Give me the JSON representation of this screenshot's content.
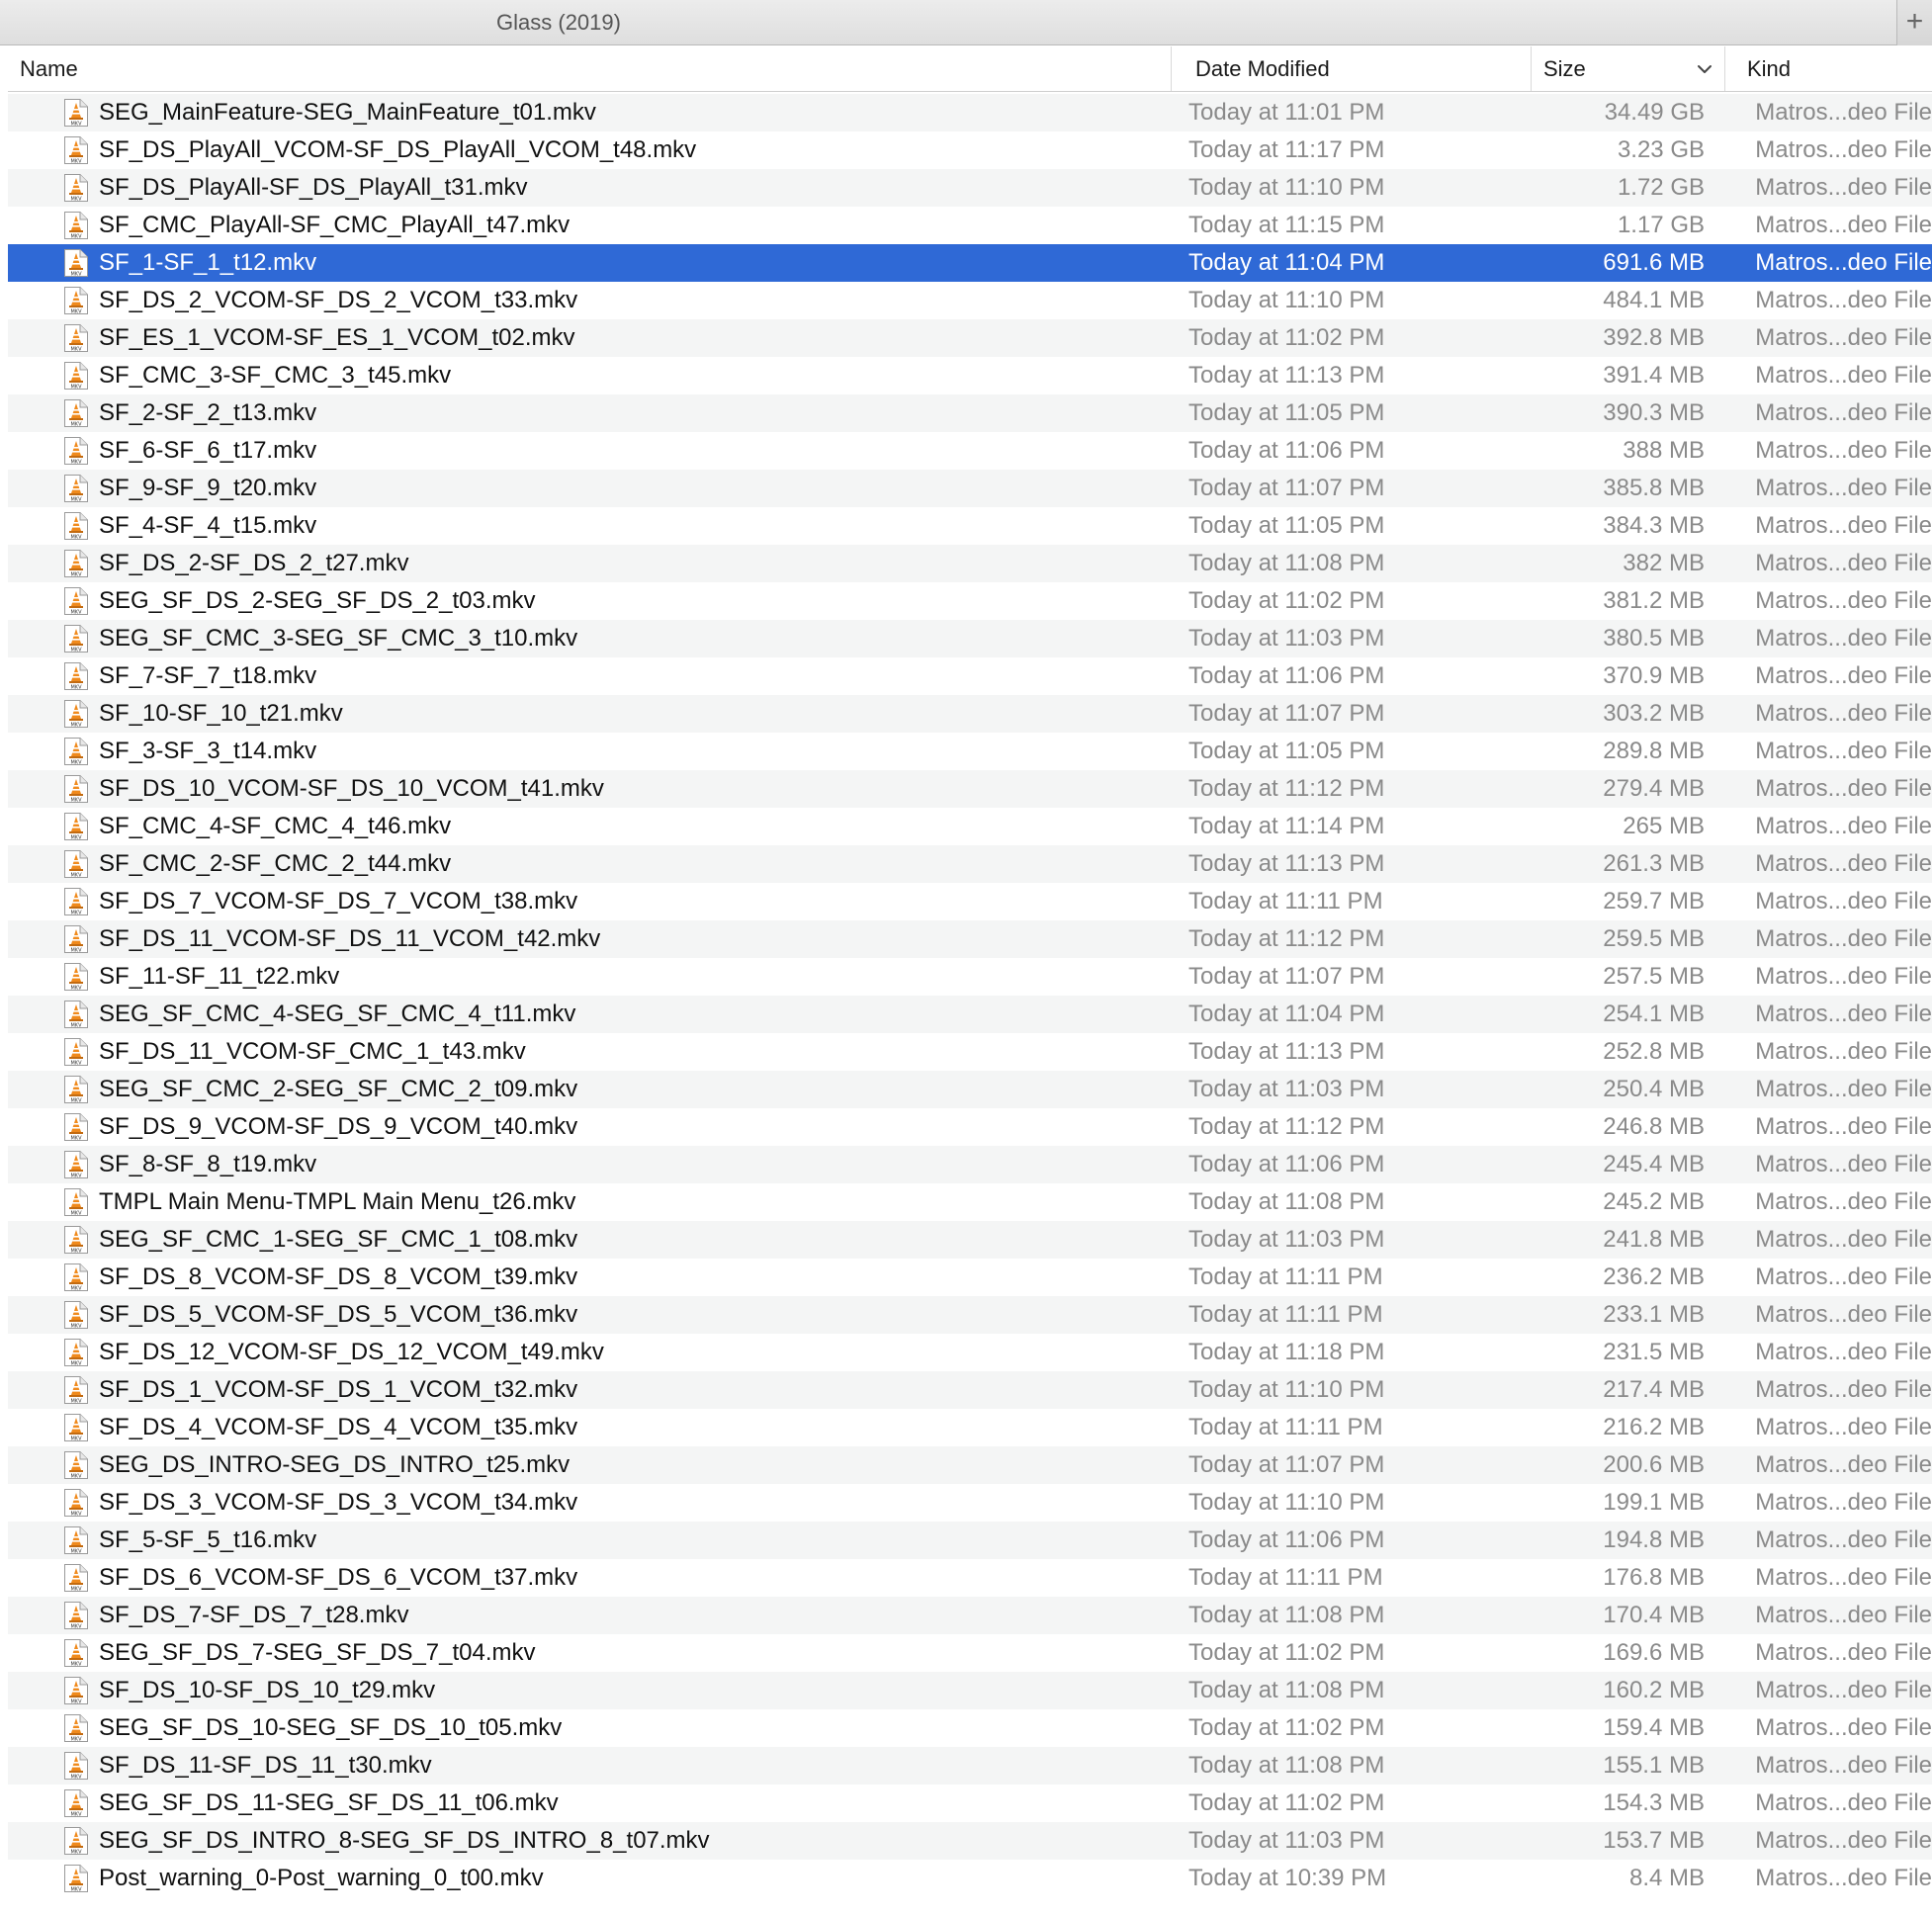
{
  "window": {
    "title": "Glass (2019)",
    "add_tab_label": "+"
  },
  "columns": {
    "name": "Name",
    "date": "Date Modified",
    "size": "Size",
    "kind": "Kind"
  },
  "selected_index": 4,
  "files": [
    {
      "name": "SEG_MainFeature-SEG_MainFeature_t01.mkv",
      "date": "Today at 11:01 PM",
      "size": "34.49 GB",
      "kind": "Matros...deo File"
    },
    {
      "name": "SF_DS_PlayAll_VCOM-SF_DS_PlayAll_VCOM_t48.mkv",
      "date": "Today at 11:17 PM",
      "size": "3.23 GB",
      "kind": "Matros...deo File"
    },
    {
      "name": "SF_DS_PlayAll-SF_DS_PlayAll_t31.mkv",
      "date": "Today at 11:10 PM",
      "size": "1.72 GB",
      "kind": "Matros...deo File"
    },
    {
      "name": "SF_CMC_PlayAll-SF_CMC_PlayAll_t47.mkv",
      "date": "Today at 11:15 PM",
      "size": "1.17 GB",
      "kind": "Matros...deo File"
    },
    {
      "name": "SF_1-SF_1_t12.mkv",
      "date": "Today at 11:04 PM",
      "size": "691.6 MB",
      "kind": "Matros...deo File"
    },
    {
      "name": "SF_DS_2_VCOM-SF_DS_2_VCOM_t33.mkv",
      "date": "Today at 11:10 PM",
      "size": "484.1 MB",
      "kind": "Matros...deo File"
    },
    {
      "name": "SF_ES_1_VCOM-SF_ES_1_VCOM_t02.mkv",
      "date": "Today at 11:02 PM",
      "size": "392.8 MB",
      "kind": "Matros...deo File"
    },
    {
      "name": "SF_CMC_3-SF_CMC_3_t45.mkv",
      "date": "Today at 11:13 PM",
      "size": "391.4 MB",
      "kind": "Matros...deo File"
    },
    {
      "name": "SF_2-SF_2_t13.mkv",
      "date": "Today at 11:05 PM",
      "size": "390.3 MB",
      "kind": "Matros...deo File"
    },
    {
      "name": "SF_6-SF_6_t17.mkv",
      "date": "Today at 11:06 PM",
      "size": "388 MB",
      "kind": "Matros...deo File"
    },
    {
      "name": "SF_9-SF_9_t20.mkv",
      "date": "Today at 11:07 PM",
      "size": "385.8 MB",
      "kind": "Matros...deo File"
    },
    {
      "name": "SF_4-SF_4_t15.mkv",
      "date": "Today at 11:05 PM",
      "size": "384.3 MB",
      "kind": "Matros...deo File"
    },
    {
      "name": "SF_DS_2-SF_DS_2_t27.mkv",
      "date": "Today at 11:08 PM",
      "size": "382 MB",
      "kind": "Matros...deo File"
    },
    {
      "name": "SEG_SF_DS_2-SEG_SF_DS_2_t03.mkv",
      "date": "Today at 11:02 PM",
      "size": "381.2 MB",
      "kind": "Matros...deo File"
    },
    {
      "name": "SEG_SF_CMC_3-SEG_SF_CMC_3_t10.mkv",
      "date": "Today at 11:03 PM",
      "size": "380.5 MB",
      "kind": "Matros...deo File"
    },
    {
      "name": "SF_7-SF_7_t18.mkv",
      "date": "Today at 11:06 PM",
      "size": "370.9 MB",
      "kind": "Matros...deo File"
    },
    {
      "name": "SF_10-SF_10_t21.mkv",
      "date": "Today at 11:07 PM",
      "size": "303.2 MB",
      "kind": "Matros...deo File"
    },
    {
      "name": "SF_3-SF_3_t14.mkv",
      "date": "Today at 11:05 PM",
      "size": "289.8 MB",
      "kind": "Matros...deo File"
    },
    {
      "name": "SF_DS_10_VCOM-SF_DS_10_VCOM_t41.mkv",
      "date": "Today at 11:12 PM",
      "size": "279.4 MB",
      "kind": "Matros...deo File"
    },
    {
      "name": "SF_CMC_4-SF_CMC_4_t46.mkv",
      "date": "Today at 11:14 PM",
      "size": "265 MB",
      "kind": "Matros...deo File"
    },
    {
      "name": "SF_CMC_2-SF_CMC_2_t44.mkv",
      "date": "Today at 11:13 PM",
      "size": "261.3 MB",
      "kind": "Matros...deo File"
    },
    {
      "name": "SF_DS_7_VCOM-SF_DS_7_VCOM_t38.mkv",
      "date": "Today at 11:11 PM",
      "size": "259.7 MB",
      "kind": "Matros...deo File"
    },
    {
      "name": "SF_DS_11_VCOM-SF_DS_11_VCOM_t42.mkv",
      "date": "Today at 11:12 PM",
      "size": "259.5 MB",
      "kind": "Matros...deo File"
    },
    {
      "name": "SF_11-SF_11_t22.mkv",
      "date": "Today at 11:07 PM",
      "size": "257.5 MB",
      "kind": "Matros...deo File"
    },
    {
      "name": "SEG_SF_CMC_4-SEG_SF_CMC_4_t11.mkv",
      "date": "Today at 11:04 PM",
      "size": "254.1 MB",
      "kind": "Matros...deo File"
    },
    {
      "name": "SF_DS_11_VCOM-SF_CMC_1_t43.mkv",
      "date": "Today at 11:13 PM",
      "size": "252.8 MB",
      "kind": "Matros...deo File"
    },
    {
      "name": "SEG_SF_CMC_2-SEG_SF_CMC_2_t09.mkv",
      "date": "Today at 11:03 PM",
      "size": "250.4 MB",
      "kind": "Matros...deo File"
    },
    {
      "name": "SF_DS_9_VCOM-SF_DS_9_VCOM_t40.mkv",
      "date": "Today at 11:12 PM",
      "size": "246.8 MB",
      "kind": "Matros...deo File"
    },
    {
      "name": "SF_8-SF_8_t19.mkv",
      "date": "Today at 11:06 PM",
      "size": "245.4 MB",
      "kind": "Matros...deo File"
    },
    {
      "name": "TMPL Main Menu-TMPL Main Menu_t26.mkv",
      "date": "Today at 11:08 PM",
      "size": "245.2 MB",
      "kind": "Matros...deo File"
    },
    {
      "name": "SEG_SF_CMC_1-SEG_SF_CMC_1_t08.mkv",
      "date": "Today at 11:03 PM",
      "size": "241.8 MB",
      "kind": "Matros...deo File"
    },
    {
      "name": "SF_DS_8_VCOM-SF_DS_8_VCOM_t39.mkv",
      "date": "Today at 11:11 PM",
      "size": "236.2 MB",
      "kind": "Matros...deo File"
    },
    {
      "name": "SF_DS_5_VCOM-SF_DS_5_VCOM_t36.mkv",
      "date": "Today at 11:11 PM",
      "size": "233.1 MB",
      "kind": "Matros...deo File"
    },
    {
      "name": "SF_DS_12_VCOM-SF_DS_12_VCOM_t49.mkv",
      "date": "Today at 11:18 PM",
      "size": "231.5 MB",
      "kind": "Matros...deo File"
    },
    {
      "name": "SF_DS_1_VCOM-SF_DS_1_VCOM_t32.mkv",
      "date": "Today at 11:10 PM",
      "size": "217.4 MB",
      "kind": "Matros...deo File"
    },
    {
      "name": "SF_DS_4_VCOM-SF_DS_4_VCOM_t35.mkv",
      "date": "Today at 11:11 PM",
      "size": "216.2 MB",
      "kind": "Matros...deo File"
    },
    {
      "name": "SEG_DS_INTRO-SEG_DS_INTRO_t25.mkv",
      "date": "Today at 11:07 PM",
      "size": "200.6 MB",
      "kind": "Matros...deo File"
    },
    {
      "name": "SF_DS_3_VCOM-SF_DS_3_VCOM_t34.mkv",
      "date": "Today at 11:10 PM",
      "size": "199.1 MB",
      "kind": "Matros...deo File"
    },
    {
      "name": "SF_5-SF_5_t16.mkv",
      "date": "Today at 11:06 PM",
      "size": "194.8 MB",
      "kind": "Matros...deo File"
    },
    {
      "name": "SF_DS_6_VCOM-SF_DS_6_VCOM_t37.mkv",
      "date": "Today at 11:11 PM",
      "size": "176.8 MB",
      "kind": "Matros...deo File"
    },
    {
      "name": "SF_DS_7-SF_DS_7_t28.mkv",
      "date": "Today at 11:08 PM",
      "size": "170.4 MB",
      "kind": "Matros...deo File"
    },
    {
      "name": "SEG_SF_DS_7-SEG_SF_DS_7_t04.mkv",
      "date": "Today at 11:02 PM",
      "size": "169.6 MB",
      "kind": "Matros...deo File"
    },
    {
      "name": "SF_DS_10-SF_DS_10_t29.mkv",
      "date": "Today at 11:08 PM",
      "size": "160.2 MB",
      "kind": "Matros...deo File"
    },
    {
      "name": "SEG_SF_DS_10-SEG_SF_DS_10_t05.mkv",
      "date": "Today at 11:02 PM",
      "size": "159.4 MB",
      "kind": "Matros...deo File"
    },
    {
      "name": "SF_DS_11-SF_DS_11_t30.mkv",
      "date": "Today at 11:08 PM",
      "size": "155.1 MB",
      "kind": "Matros...deo File"
    },
    {
      "name": "SEG_SF_DS_11-SEG_SF_DS_11_t06.mkv",
      "date": "Today at 11:02 PM",
      "size": "154.3 MB",
      "kind": "Matros...deo File"
    },
    {
      "name": "SEG_SF_DS_INTRO_8-SEG_SF_DS_INTRO_8_t07.mkv",
      "date": "Today at 11:03 PM",
      "size": "153.7 MB",
      "kind": "Matros...deo File"
    },
    {
      "name": "Post_warning_0-Post_warning_0_t00.mkv",
      "date": "Today at 10:39 PM",
      "size": "8.4 MB",
      "kind": "Matros...deo File"
    }
  ],
  "icons": {
    "file": "mkv-file-icon",
    "sort": "chevron-down-icon",
    "add_tab": "plus-icon"
  },
  "icon_label": "MKV",
  "colors": {
    "selection": "#2f69d6",
    "icon_cone": "#f08a1c"
  }
}
